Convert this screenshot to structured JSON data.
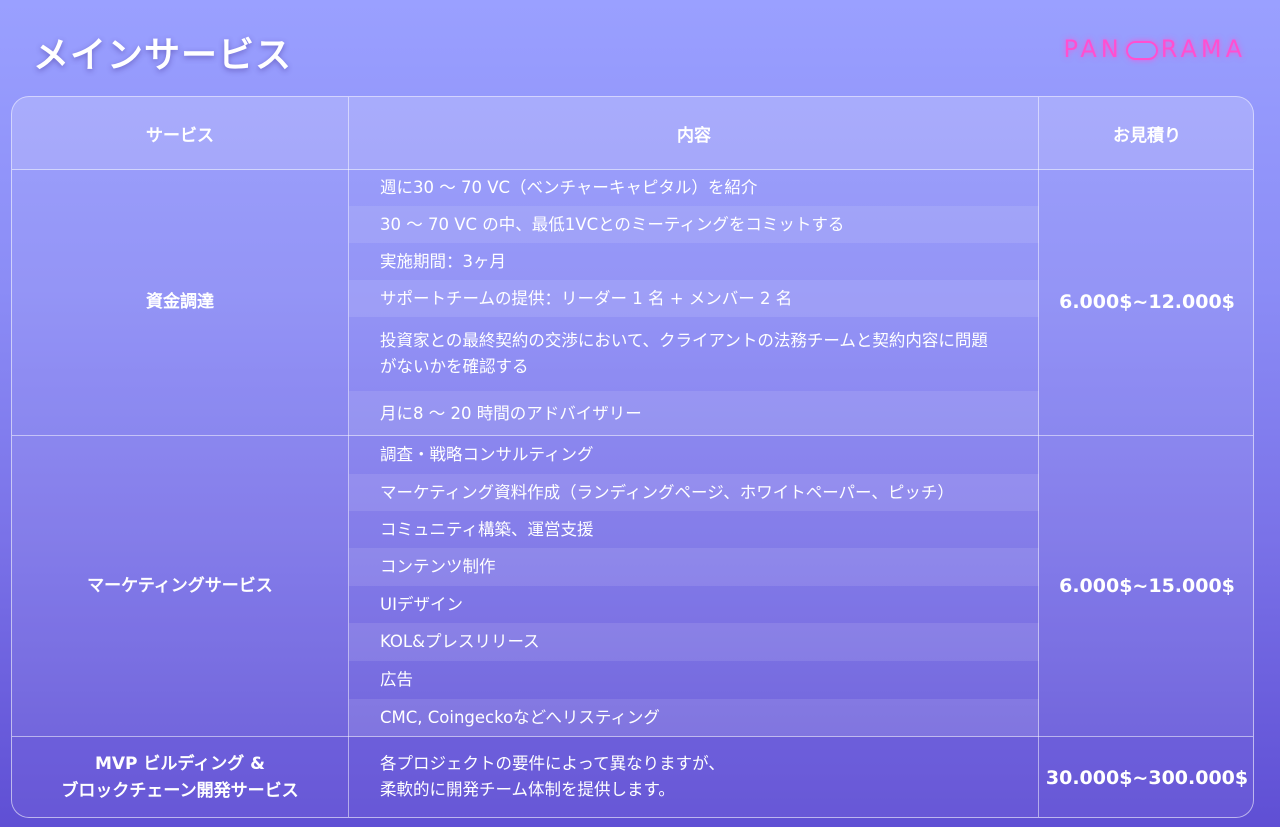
{
  "header": {
    "title": "メインサービス",
    "logo_text": "PANORAMA"
  },
  "table": {
    "columns": [
      "サービス",
      "内容",
      "お見積り"
    ],
    "rows": [
      {
        "service": "資金調達",
        "price": "6.000$~12.000$",
        "items": [
          "週に30 〜 70 VC（ベンチャーキャピタル）を紹介",
          "30 〜 70 VC の中、最低1VCとのミーティングをコミットする",
          "実施期間：3ヶ月",
          "サポートチームの提供：リーダー 1 名 + メンバー 2 名",
          "投資家との最終契約の交渉において、クライアントの法務チームと契約内容に問題がないかを確認する",
          "月に8 〜 20 時間のアドバイザリー"
        ]
      },
      {
        "service": "マーケティングサービス",
        "price": "6.000$~15.000$",
        "items": [
          "調査・戦略コンサルティング",
          "マーケティング資料作成（ランディングページ、ホワイトペーパー、ピッチ）",
          "コミュニティ構築、運営支援",
          "コンテンツ制作",
          "UIデザイン",
          "KOL&プレスリリース",
          "広告",
          "CMC, Coingeckoなどへリスティング"
        ]
      },
      {
        "service_line1": "MVP ビルディング &",
        "service_line2": "ブロックチェーン開発サービス",
        "price": "30.000$~300.000$",
        "line1": "各プロジェクトの要件によって異なりますが、",
        "line2": "柔軟的に開発チーム体制を提供します。"
      }
    ]
  }
}
